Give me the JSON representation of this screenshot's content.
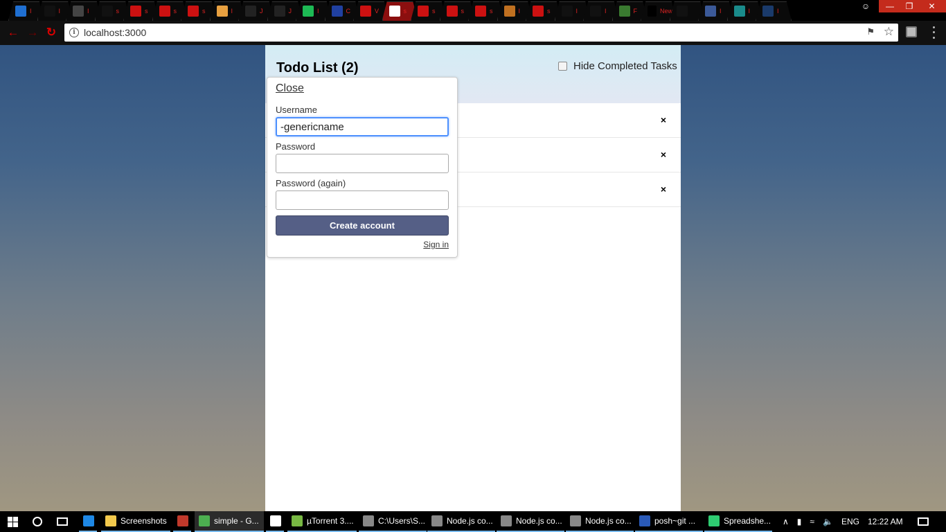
{
  "browser": {
    "tabs": [
      {
        "favicon": "mail-icon",
        "title": "I",
        "color": "#1f6fd1"
      },
      {
        "favicon": "github-icon",
        "title": "I",
        "color": "#111111"
      },
      {
        "favicon": "doc-icon",
        "title": "I",
        "color": "#444444"
      },
      {
        "favicon": "github-icon",
        "title": "s",
        "color": "#111111"
      },
      {
        "favicon": "pdf-icon",
        "title": "s",
        "color": "#cc1111"
      },
      {
        "favicon": "pdf-icon",
        "title": "s",
        "color": "#cc1111"
      },
      {
        "favicon": "pdf-icon",
        "title": "s",
        "color": "#cc1111"
      },
      {
        "favicon": "flower-icon",
        "title": "I",
        "color": "#e8a040"
      },
      {
        "favicon": "w-icon",
        "title": "J",
        "color": "#222222"
      },
      {
        "favicon": "w-icon",
        "title": "J",
        "color": "#222222"
      },
      {
        "favicon": "spotify-icon",
        "title": "I",
        "color": "#1db954"
      },
      {
        "favicon": "power-icon",
        "title": "C",
        "color": "#2040a0"
      },
      {
        "favicon": "pdf-icon",
        "title": "V",
        "color": "#cc1111"
      },
      {
        "favicon": "google-icon",
        "title": "s",
        "color": "#ffffff"
      },
      {
        "favicon": "pdf-icon",
        "title": "s",
        "color": "#cc1111"
      },
      {
        "favicon": "pdf-icon",
        "title": "s",
        "color": "#cc1111"
      },
      {
        "favicon": "pdf-icon",
        "title": "s",
        "color": "#cc1111"
      },
      {
        "favicon": "tool-icon",
        "title": "I",
        "color": "#c07020"
      },
      {
        "favicon": "pdf-icon",
        "title": "s",
        "color": "#cc1111"
      },
      {
        "favicon": "github-icon",
        "title": "I",
        "color": "#111111"
      },
      {
        "favicon": "github-icon",
        "title": "I",
        "color": "#111111"
      },
      {
        "favicon": "leaf-icon",
        "title": "F",
        "color": "#3a7a30"
      },
      {
        "favicon": "new-icon",
        "title": "New",
        "color": "#000000"
      },
      {
        "favicon": "github-icon",
        "title": "",
        "color": "#111111"
      },
      {
        "favicon": "facebook-icon",
        "title": "I",
        "color": "#3b5998"
      },
      {
        "favicon": "globe-icon",
        "title": "I",
        "color": "#1a8a8a"
      },
      {
        "favicon": "d-icon",
        "title": "I",
        "color": "#1a3a6a"
      }
    ],
    "address": "localhost:3000"
  },
  "header": {
    "title": "Todo List (2)",
    "hide_completed_label": "Hide Completed Tasks"
  },
  "tasks": [
    {
      "delete_label": "×"
    },
    {
      "delete_label": "×"
    },
    {
      "delete_label": "×"
    }
  ],
  "login": {
    "close_label": "Close",
    "username_label": "Username",
    "username_value": "-genericname",
    "password_label": "Password",
    "password_again_label": "Password (again)",
    "create_button": "Create account",
    "signin_link": "Sign in"
  },
  "taskbar": {
    "items": [
      {
        "icon": "edge-icon",
        "label": "",
        "color": "#1e88e5"
      },
      {
        "icon": "folder-icon",
        "label": "Screenshots",
        "color": "#f2c94c"
      },
      {
        "icon": "app-icon",
        "label": "",
        "color": "#c0392b"
      },
      {
        "icon": "chrome-icon",
        "label": "simple - G...",
        "color": "#4caf50"
      },
      {
        "icon": "store-icon",
        "label": "",
        "color": "#ffffff"
      },
      {
        "icon": "utorrent-icon",
        "label": "µTorrent 3....",
        "color": "#78b843"
      },
      {
        "icon": "terminal-icon",
        "label": "C:\\Users\\S...",
        "color": "#888888"
      },
      {
        "icon": "terminal-icon",
        "label": "Node.js co...",
        "color": "#888888"
      },
      {
        "icon": "terminal-icon",
        "label": "Node.js co...",
        "color": "#888888"
      },
      {
        "icon": "terminal-icon",
        "label": "Node.js co...",
        "color": "#888888"
      },
      {
        "icon": "powershell-icon",
        "label": "posh~git ...",
        "color": "#2a5ab8"
      },
      {
        "icon": "spreadsheet-icon",
        "label": "Spreadshe...",
        "color": "#2ecc71"
      }
    ],
    "language": "ENG",
    "time": "12:22 AM"
  }
}
